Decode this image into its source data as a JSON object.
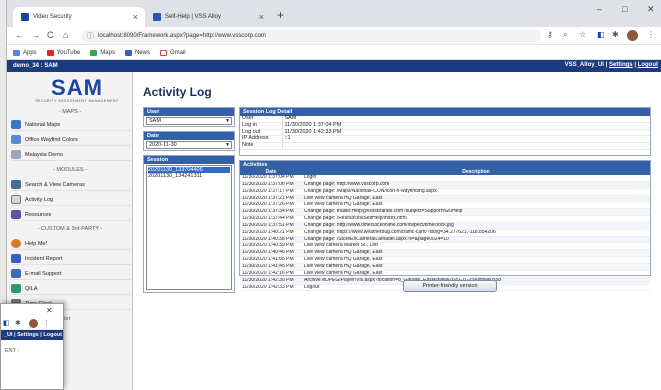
{
  "browser": {
    "tabs": [
      {
        "title": "Video Security",
        "active": true
      },
      {
        "title": "Self-Help | VSS Alloy",
        "active": false
      }
    ],
    "url": "localhost:8090/Framework.aspx?page=http://www.vsscorp.com",
    "bookmarks": [
      "Apps",
      "YouTube",
      "Maps",
      "News",
      "Gmail"
    ],
    "win_controls": {
      "min": "–",
      "max": "□",
      "close": "✕"
    }
  },
  "app": {
    "header_left": "demo_34 : SAM",
    "user": "VSS_Alloy_UI",
    "settings": "Settings",
    "logout": "Logout",
    "sep": "|",
    "logo": "SAM",
    "logo_sub": "SECURITY ASSESSMENT MANAGEMENT"
  },
  "sidebar": {
    "maps_header": "- MAPS -",
    "modules_header": "- MODULES -",
    "custom_header": "- CUSTOM & 3rd-PARTY -",
    "maps": [
      "National Maps",
      "Office Wayfind Colors",
      "Malaysia Demo"
    ],
    "modules": [
      "Search & View Cameras",
      "Activity Log",
      "Resources"
    ],
    "custom": [
      "Help Me!",
      "Incident Report",
      "E-mail Support",
      "QILA",
      "Time Clock"
    ]
  },
  "page": {
    "title": "Activity Log",
    "user_panel": {
      "label": "User",
      "value": "SAM"
    },
    "date_panel": {
      "label": "Date",
      "value": "2020-11-30"
    },
    "session_panel": {
      "label": "Session",
      "items": [
        "20201130_133704406",
        "20201130_134241311"
      ]
    },
    "detail": {
      "label": "Session Log Detail",
      "rows": [
        {
          "k": "User",
          "v": "SAM"
        },
        {
          "k": "Log in",
          "v": "11/30/2020 1:37:04 PM"
        },
        {
          "k": "Log out",
          "v": "11/30/2020 1:42:33 PM"
        },
        {
          "k": "IP Address",
          "v": "::1"
        },
        {
          "k": "Note",
          "v": ""
        }
      ]
    },
    "activities": {
      "label": "Activities",
      "col_date": "Date",
      "col_desc": "Description",
      "rows": [
        {
          "d": "11/30/2020 1:37:04 PM",
          "t": "Login"
        },
        {
          "d": "11/30/2020 1:37:06 PM",
          "t": "Change page: http://www.vsscorp.com"
        },
        {
          "d": "11/30/2020 1:37:17 PM",
          "t": "Change page: /Maps/NationalFCON/icon-h-wayfinding.aspx"
        },
        {
          "d": "11/30/2020 1:37:21 PM",
          "t": "Live view camera HQ Garage, East"
        },
        {
          "d": "11/30/2020 1:37:26 PM",
          "t": "Live view camera HQ Garage, East"
        },
        {
          "d": "11/30/2020 1:37:34 PM",
          "t": "Change page: mailto:Help@vsssbrands.com?subject=Support%20Help"
        },
        {
          "d": "11/30/2020 1:37:44 PM",
          "t": "Change page: /Resources/SelfHelp/index.html"
        },
        {
          "d": "11/30/2020 1:37:51 PM",
          "t": "Change page: http://www.timeclockonline.com/inspect/timeclock.jpg"
        },
        {
          "d": "11/30/2020 1:40:21 PM",
          "t": "Change page: https://www.weatherbug.com/traffic-cam/?sitrig=34.277621,-118.854206"
        },
        {
          "d": "11/30/2020 1:40:38 PM",
          "t": "Change page: /StoreEnCamera/Lamadel.aspx?s=&page0024=10"
        },
        {
          "d": "11/30/2020 1:40:39 PM",
          "t": "Live view camera Market St., Left"
        },
        {
          "d": "11/30/2020 1:40:46 PM",
          "t": "Live view camera HQ Garage, East"
        },
        {
          "d": "11/30/2020 1:41:05 PM",
          "t": "Live view camera HQ Garage, East"
        },
        {
          "d": "11/30/2020 1:41:45 PM",
          "t": "Live view camera HQ Garage, East"
        },
        {
          "d": "11/30/2020 1:42:16 PM",
          "t": "Live view camera HQ Garage, East"
        },
        {
          "d": "11/30/2020 1:42:30 PM",
          "t": "Archive MJPEG/Player/Vis.aspx?location=8_Garage_East&date=2020-11-25&time=0558"
        },
        {
          "d": "11/30/2020 1:42:33 PM",
          "t": "Logout"
        }
      ]
    },
    "print_button": "Printer-friendly version"
  },
  "ghost": {
    "header": "_UI | Settings | Logout",
    "menu_text": "ENT -",
    "extra": "ter"
  }
}
